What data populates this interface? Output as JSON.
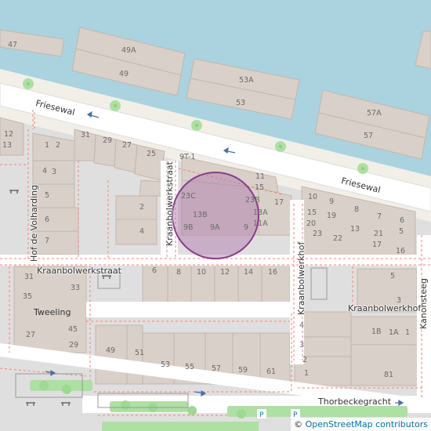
{
  "map": {
    "colors": {
      "water": "#aad3df",
      "land": "#f2efe9",
      "residential": "#e0dfdf",
      "building": "#d9d0c9",
      "building_edge": "#c4b6ab",
      "road": "#ffffff",
      "footway": "#fa8072",
      "tree": "#aedfa3",
      "marker_fill": "#b07dae",
      "marker_stroke": "#8a3d8a"
    },
    "streets": {
      "friesewal_left": "Friesewal",
      "friesewal_right": "Friesewal",
      "kraanbolwerkstraat_vertical": "Kraanbolwerkstraat",
      "kraanbolwerkstraat_horizontal": "Kraanbolwerkstraat",
      "hof_de_volharding": "Hof de Volharding",
      "kraanbolwerkhof_vertical": "Kraanbolwerkhof",
      "kraanbolwerkhof_horizontal": "Kraanbolwerkhof",
      "kanonsteeg": "Kanonsteeg",
      "thorbeckegracht": "Thorbeckegracht"
    },
    "places": {
      "tweeling": "Tweeling"
    },
    "house_numbers": {
      "n47": "47",
      "n49a": "49A",
      "n49": "49",
      "n53a": "53A",
      "n53": "53",
      "n57a": "57A",
      "n57": "57",
      "n12": "12",
      "n13": "13",
      "n1": "1",
      "n2": "2",
      "n31": "31",
      "n29": "29",
      "n27": "27",
      "n25": "25",
      "n4": "4",
      "n3": "3",
      "n6": "6",
      "n5": "5",
      "n7": "7",
      "r2": "2",
      "r4": "4",
      "n9t1": "9T-1",
      "n23c": "23C",
      "n13b": "13B",
      "n9b": "9B",
      "n9a": "9A",
      "n9": "9",
      "n11": "11",
      "n15": "15",
      "n23b": "23B",
      "n13a": "13A",
      "n11a": "11A",
      "n17": "17",
      "e10": "10",
      "e9": "9",
      "e8": "8",
      "e7": "7",
      "e15": "15",
      "e19": "19",
      "e13": "13",
      "e20": "20",
      "e6": "6",
      "e23": "23",
      "e22": "22",
      "e21": "21",
      "e5": "5",
      "e17": "17",
      "e16": "16",
      "s31": "31",
      "s33": "33",
      "s35": "35",
      "s45": "45",
      "s27": "27",
      "s29": "29",
      "k6": "6",
      "k8": "8",
      "k10": "10",
      "k12": "12",
      "k14": "14",
      "k16": "16",
      "b49": "49",
      "b51": "51",
      "b53": "53",
      "b55": "55",
      "b57": "57",
      "b59": "59",
      "b61": "61",
      "h5": "5",
      "h3": "3",
      "w4": "4",
      "w3": "3",
      "w2": "2",
      "w1": "1",
      "h1b": "1B",
      "h1a": "1A",
      "h1": "1",
      "h81": "81"
    },
    "attribution": {
      "copyright": "©",
      "link": "OpenStreetMap contributors"
    },
    "marker": {
      "label": ""
    }
  }
}
